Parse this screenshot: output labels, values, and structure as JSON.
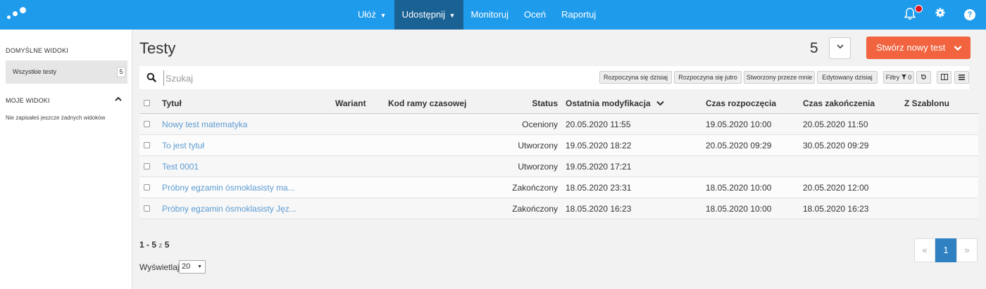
{
  "topbar": {
    "nav": [
      {
        "label": "Ułóż",
        "caret": "⌄"
      },
      {
        "label": "Udostępnij",
        "caret": "⌄"
      },
      {
        "label": "Monitoruj"
      },
      {
        "label": "Oceń"
      },
      {
        "label": "Raportuj"
      }
    ],
    "icons": [
      "bell-icon",
      "gear-icon",
      "help-icon"
    ],
    "help_glyph": "?",
    "brand_color": "#1f9bec",
    "active_nav_color": "#1b6294"
  },
  "sidebar": {
    "default_views_heading": "DOMYŚLNE WIDOKI",
    "all_tests_label": "Wszystkie testy",
    "all_tests_count": "5",
    "my_views_heading": "MOJE WIDOKI",
    "empty_text": "Nie zapisałeś jeszcze żadnych widoków"
  },
  "main": {
    "title": "Testy",
    "count": "5",
    "create_button": "Stwórz nowy test",
    "create_button_color": "#f26440",
    "search": {
      "placeholder": "Szukaj"
    },
    "filter_buttons": {
      "started_today": "Rozpoczyna się dzisiaj",
      "starts_tomorrow": "Rozpoczyna się jutro",
      "created_by_me": "Stworzony przeze mnie",
      "edited_today": "Edytowany dzisiaj",
      "filters": "Filtry",
      "filters_count": "0"
    }
  },
  "table": {
    "columns": {
      "title": "Tytuł",
      "variant": "Wariant",
      "time_frame_code": "Kod ramy czasowej",
      "status": "Status",
      "last_modified": "Ostatnia modyfikacja",
      "start_time": "Czas rozpoczęcia",
      "end_time": "Czas zakończenia",
      "from_template": "Z Szablonu"
    },
    "rows": [
      {
        "title": "Nowy test matematyka",
        "status": "Oceniony",
        "last_modified": "20.05.2020 11:55",
        "start_time": "19.05.2020 10:00",
        "end_time": "20.05.2020 11:50"
      },
      {
        "title": "To jest tytuł",
        "status": "Utworzony",
        "last_modified": "19.05.2020 18:22",
        "start_time": "20.05.2020 09:29",
        "end_time": "30.05.2020 09:29"
      },
      {
        "title": "Test 0001",
        "status": "Utworzony",
        "last_modified": "19.05.2020 17:21",
        "start_time": "",
        "end_time": ""
      },
      {
        "title": "Próbny egzamin ósmoklasisty ma...",
        "status": "Zakończony",
        "last_modified": "18.05.2020 23:31",
        "start_time": "18.05.2020 10:00",
        "end_time": "20.05.2020 12:00"
      },
      {
        "title": "Próbny egzamin ósmoklasisty Jęz...",
        "status": "Zakończony",
        "last_modified": "18.05.2020 16:23",
        "start_time": "18.05.2020 10:00",
        "end_time": "18.05.2020 16:23"
      }
    ]
  },
  "pagination": {
    "range": "1 - 5",
    "of": "z",
    "total": "5",
    "per_page_label": "Wyświetlaj",
    "per_page_value": "20",
    "prev": "«",
    "current": "1",
    "next": "»"
  }
}
